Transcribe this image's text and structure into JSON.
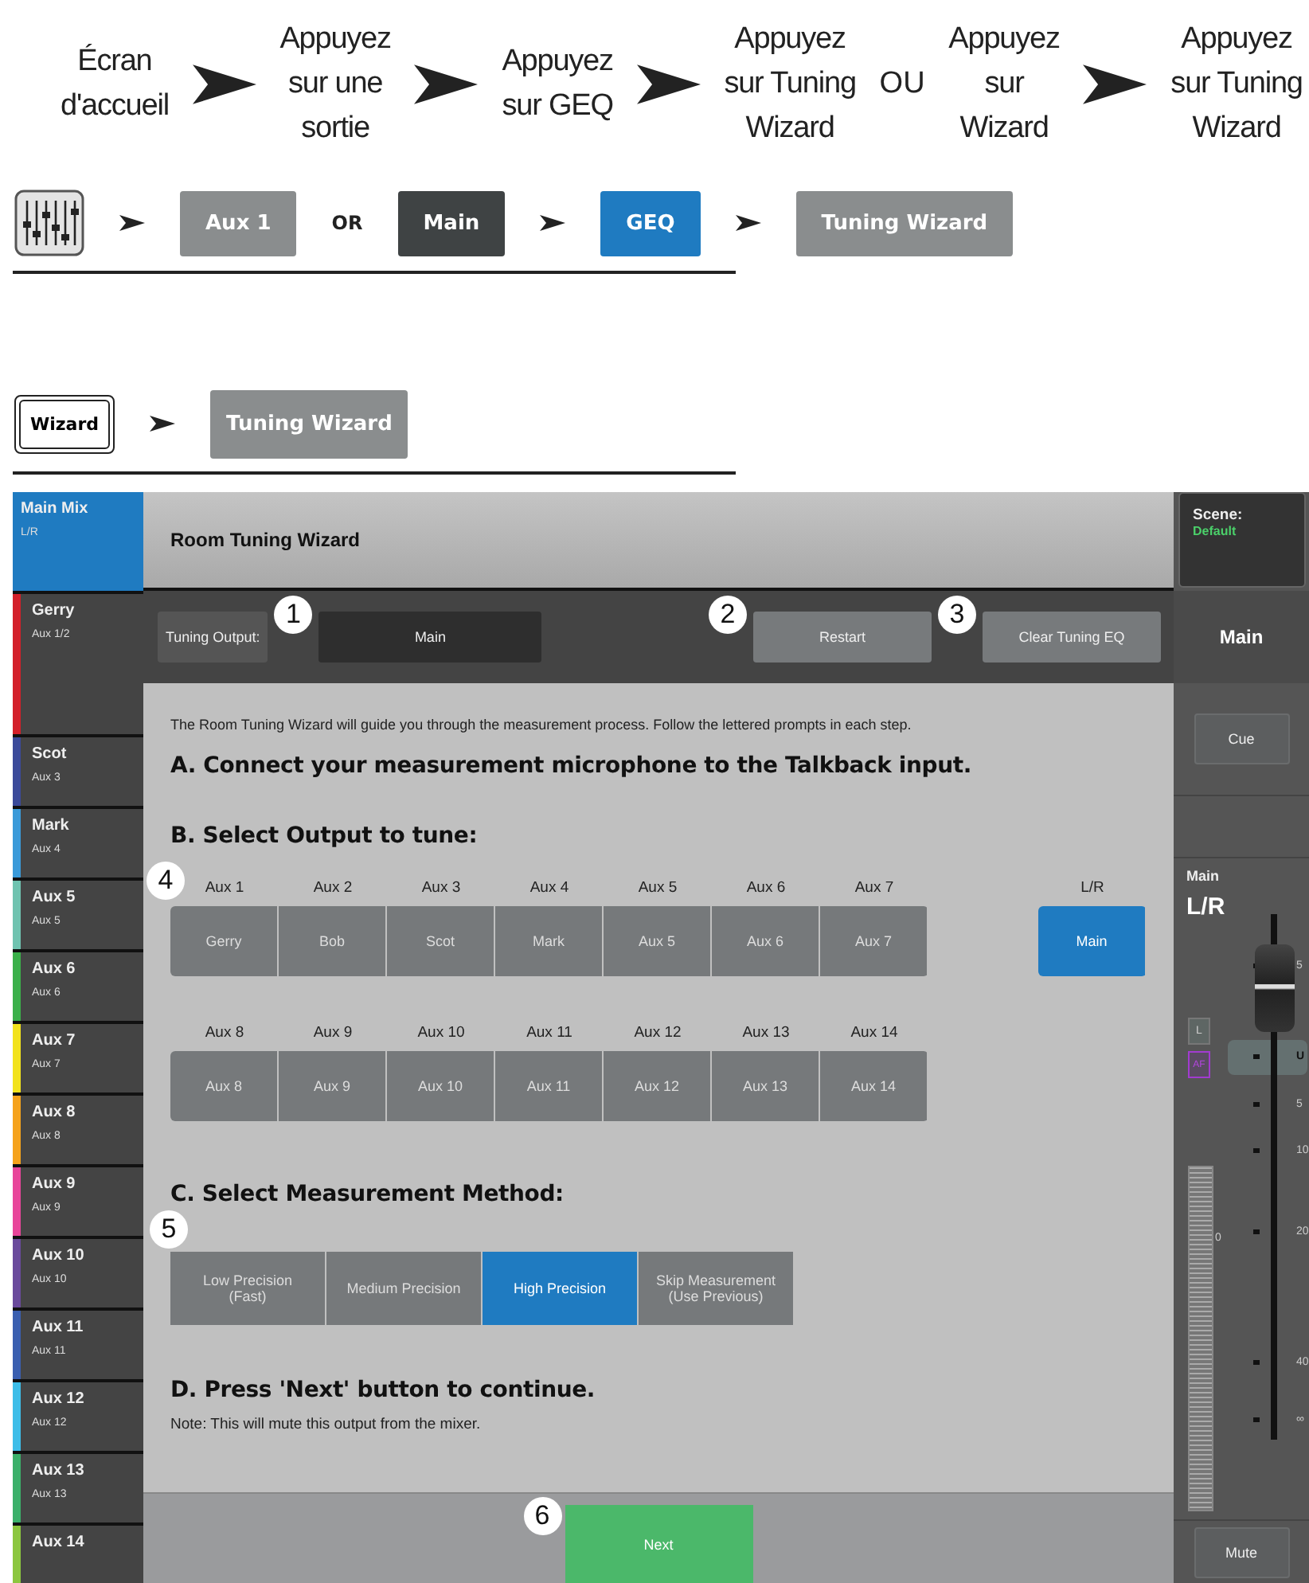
{
  "flow_steps": [
    {
      "kind": "step",
      "text": "Écran\nd'accueil"
    },
    {
      "kind": "step",
      "text": "Appuyez\nsur une\nsortie"
    },
    {
      "kind": "step",
      "text": "Appuyez\nsur GEQ"
    },
    {
      "kind": "step",
      "text": "Appuyez\nsur Tuning\nWizard"
    },
    {
      "kind": "or",
      "text": "OU"
    },
    {
      "kind": "step",
      "text": "Appuyez\nsur\nWizard"
    },
    {
      "kind": "step",
      "text": "Appuyez\nsur Tuning\nWizard"
    }
  ],
  "path_a": [
    {
      "kind": "button",
      "label": "Aux 1",
      "color": "#8a8d8e"
    },
    {
      "kind": "or",
      "label": "OR"
    },
    {
      "kind": "button",
      "label": "Main",
      "color": "#3f4344"
    },
    {
      "kind": "arrow"
    },
    {
      "kind": "button",
      "label": "GEQ",
      "color": "#1f7bc1"
    },
    {
      "kind": "arrow"
    },
    {
      "kind": "button",
      "label": "Tuning Wizard",
      "color": "#8a8d8e"
    }
  ],
  "path_b": {
    "start": "Wizard",
    "target": "Tuning Wizard"
  },
  "app": {
    "sidebar": [
      {
        "name": "Main Mix",
        "sub": "L/R",
        "selected": true,
        "color": "#1f7bc1"
      },
      {
        "name": "Gerry",
        "sub": "Aux 1/2",
        "selected": false,
        "color": "#d3202a"
      },
      {
        "name": "Scot",
        "sub": "Aux 3",
        "selected": false,
        "color": "#3b4a9a"
      },
      {
        "name": "Mark",
        "sub": "Aux 4",
        "selected": false,
        "color": "#3a9ad9"
      },
      {
        "name": "Aux 5",
        "sub": "Aux 5",
        "selected": false,
        "color": "#6fc3b0"
      },
      {
        "name": "Aux 6",
        "sub": "Aux 6",
        "selected": false,
        "color": "#3bb04a"
      },
      {
        "name": "Aux 7",
        "sub": "Aux 7",
        "selected": false,
        "color": "#f2e21b"
      },
      {
        "name": "Aux 8",
        "sub": "Aux 8",
        "selected": false,
        "color": "#f5a21b"
      },
      {
        "name": "Aux 9",
        "sub": "Aux 9",
        "selected": false,
        "color": "#e8459a"
      },
      {
        "name": "Aux 10",
        "sub": "Aux 10",
        "selected": false,
        "color": "#6a4a9c"
      },
      {
        "name": "Aux 11",
        "sub": "Aux 11",
        "selected": false,
        "color": "#3a5fb0"
      },
      {
        "name": "Aux 12",
        "sub": "Aux 12",
        "selected": false,
        "color": "#3dbde8"
      },
      {
        "name": "Aux 13",
        "sub": "Aux 13",
        "selected": false,
        "color": "#3bb06a"
      },
      {
        "name": "Aux 14",
        "selected": false,
        "color": "#8cc63f"
      }
    ],
    "title": "Room Tuning Wizard",
    "tuning_output": {
      "label": "Tuning Output:",
      "value": "Main"
    },
    "toolbar_buttons": [
      "Restart",
      "Clear Tuning EQ"
    ],
    "intro": "The Room Tuning Wizard will guide you through the measurement process. Follow the lettered prompts in each step.",
    "step_a": "A. Connect your measurement microphone to the Talkback input.",
    "step_b": "B. Select Output to tune:",
    "output_rows": [
      [
        {
          "header": "Aux 1",
          "label": "Gerry",
          "selected": false
        },
        {
          "header": "Aux 2",
          "label": "Bob",
          "selected": false
        },
        {
          "header": "Aux 3",
          "label": "Scot",
          "selected": false
        },
        {
          "header": "Aux 4",
          "label": "Mark",
          "selected": false
        },
        {
          "header": "Aux 5",
          "label": "Aux 5",
          "selected": false
        },
        {
          "header": "Aux 6",
          "label": "Aux 6",
          "selected": false
        },
        {
          "header": "Aux 7",
          "label": "Aux 7",
          "selected": false
        }
      ],
      [
        {
          "header": "Aux 8",
          "label": "Aux 8",
          "selected": false
        },
        {
          "header": "Aux 9",
          "label": "Aux 9",
          "selected": false
        },
        {
          "header": "Aux 10",
          "label": "Aux 10",
          "selected": false
        },
        {
          "header": "Aux 11",
          "label": "Aux 11",
          "selected": false
        },
        {
          "header": "Aux 12",
          "label": "Aux 12",
          "selected": false
        },
        {
          "header": "Aux 13",
          "label": "Aux 13",
          "selected": false
        },
        {
          "header": "Aux 14",
          "label": "Aux 14",
          "selected": false
        }
      ]
    ],
    "lr_output": {
      "header": "L/R",
      "label": "Main",
      "selected": true
    },
    "step_c": "C. Select Measurement Method:",
    "methods": [
      {
        "label": "Low Precision\n(Fast)",
        "selected": false
      },
      {
        "label": "Medium Precision",
        "selected": false
      },
      {
        "label": "High Precision",
        "selected": true
      },
      {
        "label": "Skip Measurement\n(Use Previous)",
        "selected": false
      }
    ],
    "step_d": "D. Press 'Next' button to continue.",
    "note": "Note: This will mute this output from the mixer.",
    "next_button": "Next",
    "scene": {
      "label": "Scene:",
      "value": "Default"
    },
    "channel_header": "Main",
    "cue_button": "Cue",
    "strip": {
      "label": "Main",
      "name": "L/R",
      "l_button": "L",
      "af_button": "AF",
      "meter_label": "0",
      "fader": {
        "level": 0.93
      },
      "ticks": [
        "5",
        "U",
        "5",
        "10",
        "20",
        "40",
        "∞"
      ]
    },
    "mute_button": "Mute",
    "callouts": [
      "1",
      "2",
      "3",
      "4",
      "5",
      "6"
    ]
  }
}
